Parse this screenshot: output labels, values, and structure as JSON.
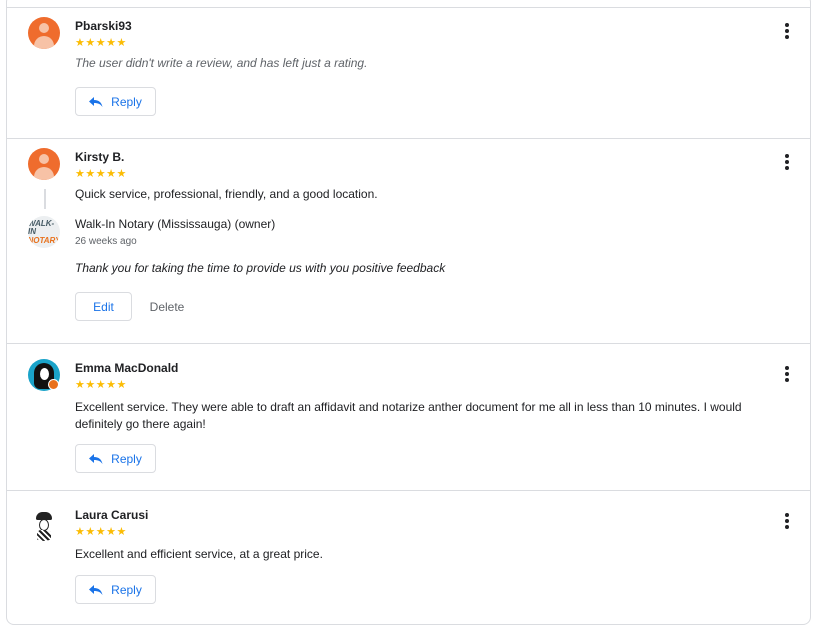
{
  "reviews": [
    {
      "name": "Pbarski93",
      "stars": "★★★★★",
      "rating": 5,
      "text": "The user didn't write a review, and has left just a rating.",
      "reply_label": "Reply"
    },
    {
      "name": "Kirsty B.",
      "stars": "★★★★★",
      "rating": 5,
      "text": "Quick service, professional, friendly, and a good location.",
      "owner": {
        "logo_line1": "WALK-IN",
        "logo_line2": "NOTARY",
        "name": "Walk-In Notary (Mississauga) (owner)",
        "time": "26 weeks ago",
        "text": "Thank you for taking the time to provide us with you positive feedback"
      },
      "edit_label": "Edit",
      "delete_label": "Delete"
    },
    {
      "name": "Emma MacDonald",
      "stars": "★★★★★",
      "rating": 5,
      "text": "Excellent service. They were able to draft an affidavit and notarize anther document for me all in less than 10 minutes. I would definitely go there again!",
      "reply_label": "Reply"
    },
    {
      "name": "Laura Carusi",
      "stars": "★★★★★",
      "rating": 5,
      "text": "Excellent and efficient service, at a great price.",
      "reply_label": "Reply"
    }
  ],
  "icons": {
    "more": "more-vert-icon",
    "reply": "reply-arrow-icon"
  },
  "colors": {
    "accent": "#1a73e8",
    "star": "#fbbc04",
    "avatar_generic": "#ef6c2d",
    "border": "#dadce0"
  }
}
